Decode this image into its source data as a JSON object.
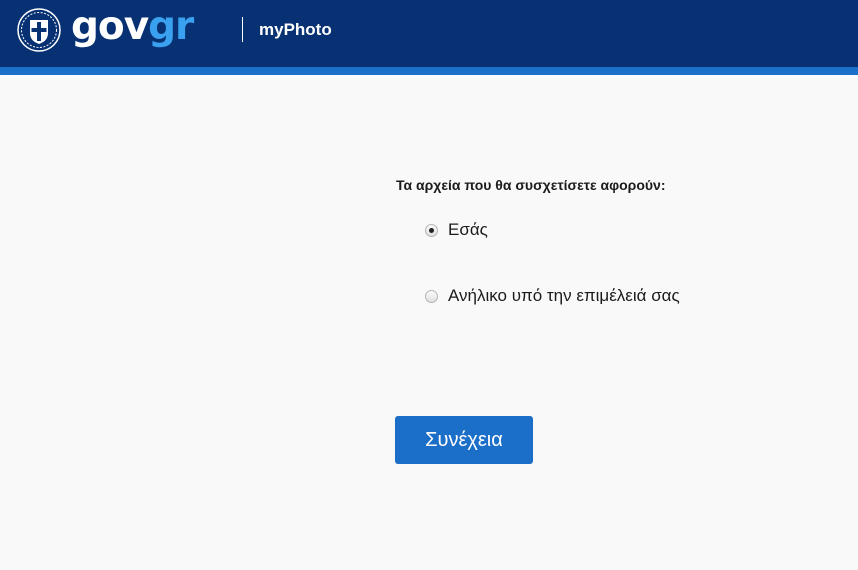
{
  "header": {
    "logo_gov": "gov",
    "logo_gr": "gr",
    "app_name": "myPhoto",
    "background_color": "#073173",
    "stripe_color": "#1c6fc9",
    "emblem_icon": "greek-state-emblem-icon"
  },
  "form": {
    "question": "Τα αρχεία που θα συσχετίσετε αφορούν:",
    "options": [
      {
        "label": "Εσάς",
        "selected": true
      },
      {
        "label": "Ανήλικο υπό την επιμέλειά σας",
        "selected": false
      }
    ],
    "continue_label": "Συνέχεια",
    "button_color": "#1c6fc9"
  }
}
